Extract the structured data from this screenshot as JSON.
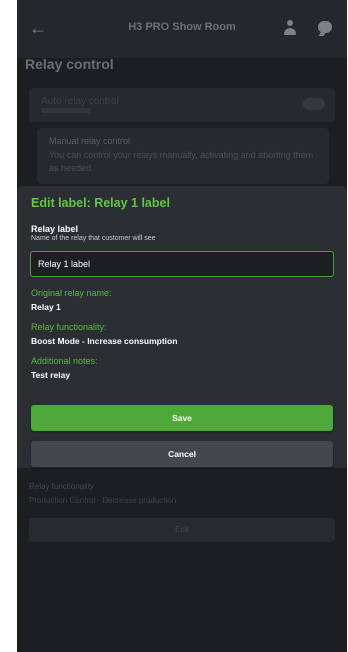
{
  "topbar": {
    "title": "H3 PRO Show Room",
    "back_icon": "arrow-left-icon",
    "user_icon": "user-icon",
    "chat_icon": "chat-icon"
  },
  "page": {
    "heading": "Relay control"
  },
  "background": {
    "auto_relay_label": "Auto relay control",
    "manual_label": "Manual relay control",
    "manual_desc": "You can control your relays manually, activating and aborting them as needed.",
    "relay2_func_key": "Relay functionality",
    "relay2_func_val": "Production Control - Decrease production",
    "edit_label": "Edit"
  },
  "modal": {
    "title": "Edit label: Relay 1 label",
    "field_label": "Relay label",
    "field_hint": "Name of the relay that customer will see",
    "input_value": "Relay 1 label",
    "original_name_key": "Original relay name:",
    "original_name_val": "Relay 1",
    "functionality_key": "Relay functionality:",
    "functionality_val": "Boost Mode - Increase consumption",
    "notes_key": "Additional notes:",
    "notes_val": "Test relay",
    "save_label": "Save",
    "cancel_label": "Cancel"
  },
  "colors": {
    "accent_green": "#62c548",
    "save_button": "#4fa83a",
    "cancel_button": "#44474d",
    "modal_bg": "#2b2e33",
    "screen_bg": "#1c1e22"
  }
}
